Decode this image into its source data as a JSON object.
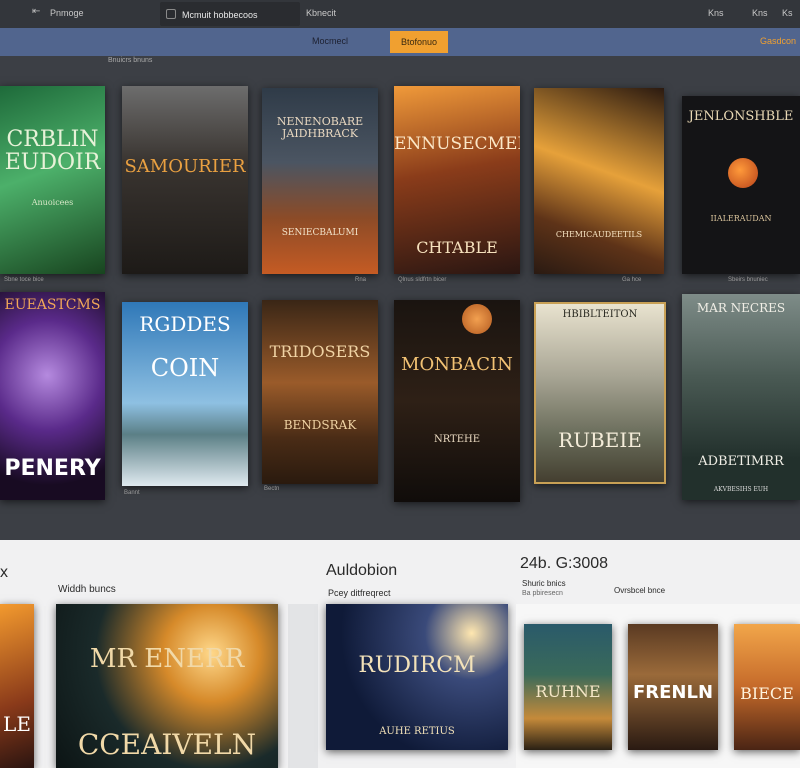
{
  "topbar": {
    "left_text": "Pnmoge",
    "tab_title": "Mcmuit hobbecoos",
    "breadcrumb": "Kbnecit",
    "right_text_1": "Kns",
    "right_text_2": "Kns",
    "right_text_3": "Ks"
  },
  "nav": {
    "center_label": "Mocmecl",
    "active_label": "Btofonuo",
    "right_label": "Gasdcon"
  },
  "section_label": "Bnuicrs bnuns",
  "books_row1": [
    {
      "title": "CRBLIN EUDOIR",
      "subtitle": "Anuoicees",
      "caption": "Sbne toce bice"
    },
    {
      "title": "SAMOURIER",
      "subtitle": "",
      "caption": ""
    },
    {
      "title": "NENENOBARE JAIDHBRACK",
      "subtitle": "SENIECBALUMI",
      "caption": "Rna"
    },
    {
      "title": "ENNUSECMER",
      "subtitle": "CHTABLE",
      "caption": "Qlnus sldfrtn bicer"
    },
    {
      "title": "",
      "subtitle": "CHEMICAUDEETILS",
      "caption": "Ga hce"
    },
    {
      "title": "JENLONSHBLE",
      "subtitle": "IIALERAUDAN",
      "caption": "Sbeirs bnuniec"
    }
  ],
  "books_row2": [
    {
      "title": "EUEASTCMS",
      "subtitle": "PENERY",
      "caption": ""
    },
    {
      "title": "RGDDES",
      "subtitle": "COIN",
      "caption": "Bannt"
    },
    {
      "title": "TRIDOSERS",
      "subtitle": "BENDSRAK",
      "caption": "Bectn"
    },
    {
      "title": "MONBACIN",
      "subtitle": "NRTEHE",
      "caption": ""
    },
    {
      "title": "HBIBLTEITON",
      "subtitle": "RUBEIE",
      "caption": ""
    },
    {
      "title": "MAR NECRES",
      "subtitle": "ADBETIMRR",
      "caption": "AKVBESIHS EUH"
    }
  ],
  "bottom": {
    "left_cut": "x",
    "col1_heading": "Widdh buncs",
    "col2_title": "Auldobion",
    "col2_sub": "Pcey ditfreqrect",
    "col3_title": "24b. G:3008",
    "col3_sub1": "Shuric bnics",
    "col3_sub2": "Ovrsbcel bnce",
    "col3_sub3": "Ba pbiresecn",
    "big_cover_title": "MR ENERR",
    "big_cover_sub": "CCEAIVELN",
    "mid_cover_title": "RUDIRCM",
    "mid_cover_sub": "AUHE RETIUS",
    "small_covers": [
      "RUHNE",
      "FRENLN",
      "BIECE"
    ],
    "left_cover_title": "LE"
  },
  "colors": {
    "topbar": "#33363b",
    "nav": "#51658e",
    "accent": "#f0a030",
    "body": "#3c3f45",
    "panel": "#f1f1f2"
  }
}
